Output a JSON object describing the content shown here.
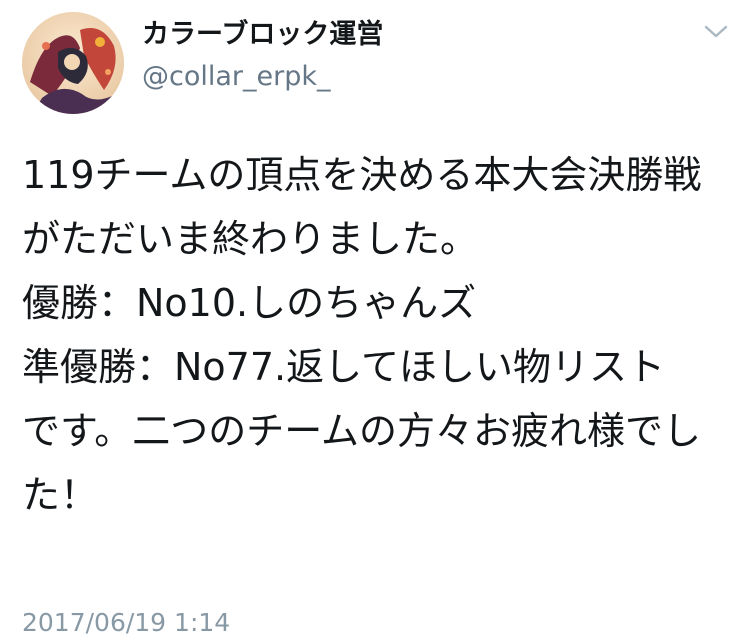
{
  "tweet": {
    "author": {
      "display_name": "カラーブロック運営",
      "handle": "@collar_erpk_",
      "avatar_icon": "avatar-illustration-icon"
    },
    "menu_icon": "chevron-down-icon",
    "text": "119チームの頂点を決める本大会決勝戦がただいま終わりました。\n優勝：No10.しのちゃんズ\n準優勝：No77.返してほしい物リスト\nです。二つのチームの方々お疲れ様でした！",
    "timestamp": "2017/06/19 1:14"
  },
  "colors": {
    "text_primary": "#14171a",
    "text_secondary": "#657786",
    "timestamp": "#8899a6",
    "caret": "#aab8c2"
  }
}
